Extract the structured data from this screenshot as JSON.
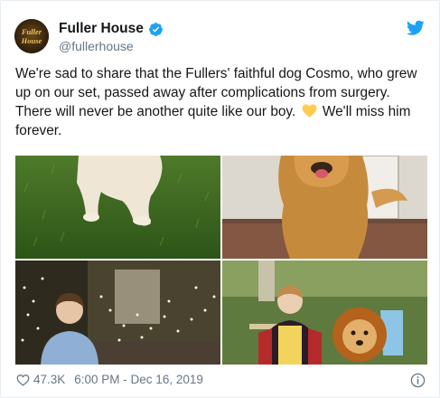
{
  "account": {
    "display_name": "Fuller House",
    "handle": "@fullerhouse",
    "avatar_text": "Fuller House",
    "verified": true
  },
  "tweet": {
    "text_before_emoji": "We're sad to share that the Fullers' faithful dog Cosmo, who grew up on our set, passed away after complications from surgery. There will never be another quite like our boy.",
    "text_after_emoji": "We'll miss him forever.",
    "emoji": "yellow-heart-emoji"
  },
  "media": {
    "images": [
      {
        "name": "dog-on-grass-photo"
      },
      {
        "name": "golden-retriever-indoors-photo"
      },
      {
        "name": "boy-with-string-lights-photo"
      },
      {
        "name": "boy-and-dog-lion-costume-photo"
      }
    ]
  },
  "footer": {
    "likes": "47.3K",
    "timestamp": "6:00 PM - Dec 16, 2019"
  },
  "colors": {
    "twitter_blue": "#1da1f2",
    "secondary_text": "#657786",
    "primary_text": "#14171a",
    "heart_yellow": "#ffcc4d"
  },
  "icons": [
    "verified-badge-icon",
    "twitter-bird-icon",
    "heart-outline-icon",
    "info-icon"
  ]
}
